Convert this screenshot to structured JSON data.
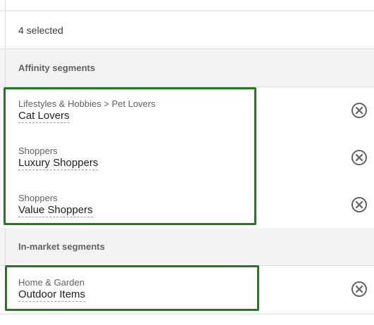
{
  "selection": {
    "count_label": "4 selected"
  },
  "sections": [
    {
      "title": "Affinity segments",
      "segments": [
        {
          "path": "Lifestyles & Hobbies > Pet Lovers",
          "name": "Cat Lovers"
        },
        {
          "path": "Shoppers",
          "name": "Luxury Shoppers"
        },
        {
          "path": "Shoppers",
          "name": "Value Shoppers"
        }
      ]
    },
    {
      "title": "In-market segments",
      "segments": [
        {
          "path": "Home & Garden",
          "name": "Outdoor Items"
        }
      ]
    }
  ],
  "icons": {
    "remove": "remove-circle-icon"
  },
  "colors": {
    "highlight": "#1a7f17",
    "section_bg": "#f3f3f3",
    "divider": "#dadce0"
  }
}
